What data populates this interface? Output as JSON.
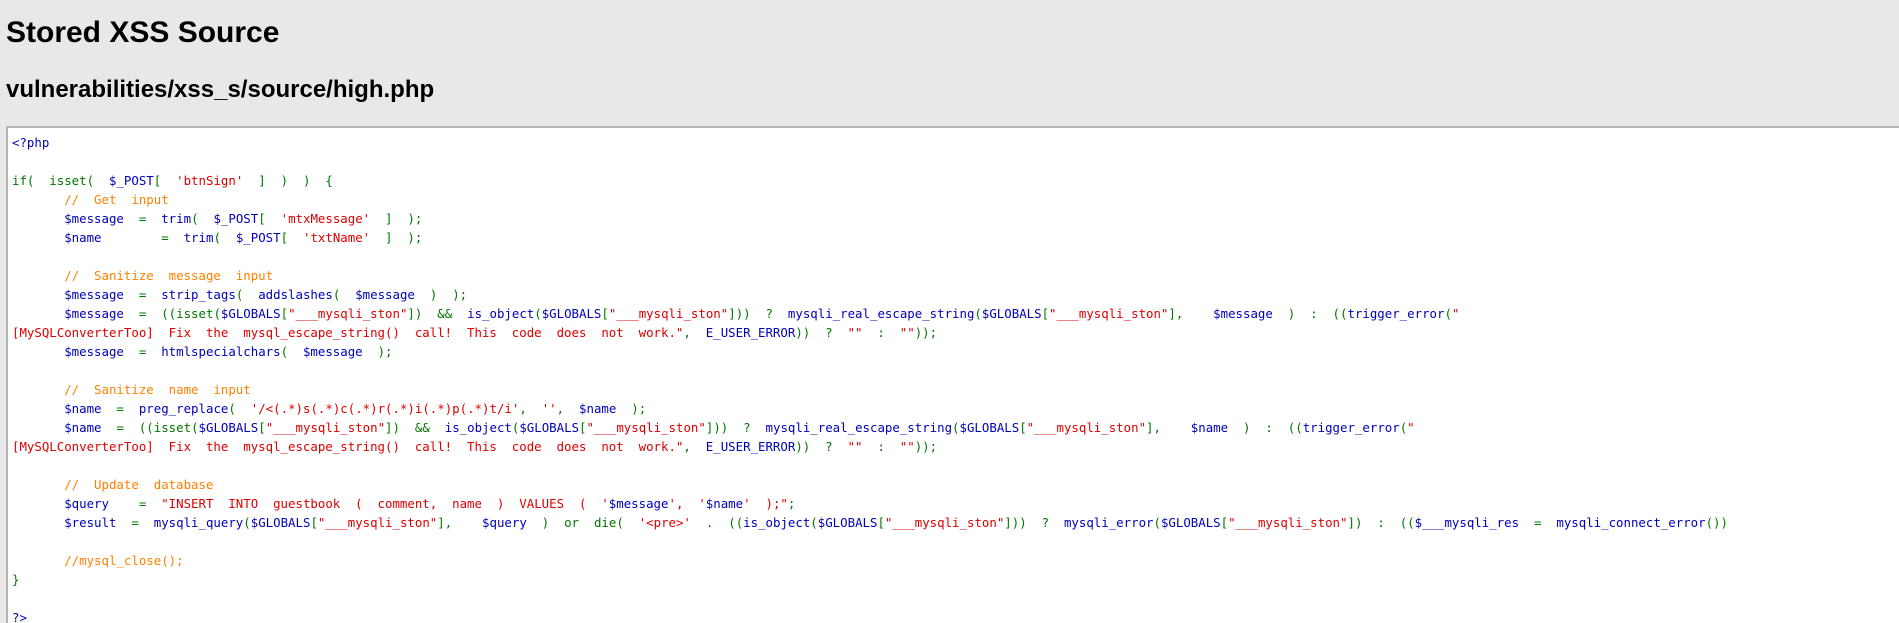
{
  "page": {
    "title": "Stored XSS Source",
    "file_path": "vulnerabilities/xss_s/source/high.php"
  },
  "source_code": {
    "lines": [
      [
        {
          "t": "<?php",
          "c": "html"
        }
      ],
      [],
      [
        {
          "t": "if(  isset(  ",
          "c": "kw"
        },
        {
          "t": "$_POST",
          "c": "var"
        },
        {
          "t": "[  ",
          "c": "kw"
        },
        {
          "t": "'btnSign'",
          "c": "str"
        },
        {
          "t": "  ]  )  )  {",
          "c": "kw"
        }
      ],
      [
        {
          "t": "       ",
          "c": "kw"
        },
        {
          "t": "//  Get  input",
          "c": "com"
        }
      ],
      [
        {
          "t": "       ",
          "c": "kw"
        },
        {
          "t": "$message",
          "c": "var"
        },
        {
          "t": "  =  ",
          "c": "kw"
        },
        {
          "t": "trim",
          "c": "var"
        },
        {
          "t": "(  ",
          "c": "kw"
        },
        {
          "t": "$_POST",
          "c": "var"
        },
        {
          "t": "[  ",
          "c": "kw"
        },
        {
          "t": "'mtxMessage'",
          "c": "str"
        },
        {
          "t": "  ]  );",
          "c": "kw"
        }
      ],
      [
        {
          "t": "       ",
          "c": "kw"
        },
        {
          "t": "$name",
          "c": "var"
        },
        {
          "t": "        =  ",
          "c": "kw"
        },
        {
          "t": "trim",
          "c": "var"
        },
        {
          "t": "(  ",
          "c": "kw"
        },
        {
          "t": "$_POST",
          "c": "var"
        },
        {
          "t": "[  ",
          "c": "kw"
        },
        {
          "t": "'txtName'",
          "c": "str"
        },
        {
          "t": "  ]  );",
          "c": "kw"
        }
      ],
      [],
      [
        {
          "t": "       ",
          "c": "kw"
        },
        {
          "t": "//  Sanitize  message  input",
          "c": "com"
        }
      ],
      [
        {
          "t": "       ",
          "c": "kw"
        },
        {
          "t": "$message",
          "c": "var"
        },
        {
          "t": "  =  ",
          "c": "kw"
        },
        {
          "t": "strip_tags",
          "c": "var"
        },
        {
          "t": "(  ",
          "c": "kw"
        },
        {
          "t": "addslashes",
          "c": "var"
        },
        {
          "t": "(  ",
          "c": "kw"
        },
        {
          "t": "$message",
          "c": "var"
        },
        {
          "t": "  )  );",
          "c": "kw"
        }
      ],
      [
        {
          "t": "       ",
          "c": "kw"
        },
        {
          "t": "$message",
          "c": "var"
        },
        {
          "t": "  =  ((",
          "c": "kw"
        },
        {
          "t": "isset",
          "c": "kw"
        },
        {
          "t": "(",
          "c": "kw"
        },
        {
          "t": "$GLOBALS",
          "c": "var"
        },
        {
          "t": "[",
          "c": "kw"
        },
        {
          "t": "\"___mysqli_ston\"",
          "c": "str"
        },
        {
          "t": "])  &&  ",
          "c": "kw"
        },
        {
          "t": "is_object",
          "c": "var"
        },
        {
          "t": "(",
          "c": "kw"
        },
        {
          "t": "$GLOBALS",
          "c": "var"
        },
        {
          "t": "[",
          "c": "kw"
        },
        {
          "t": "\"___mysqli_ston\"",
          "c": "str"
        },
        {
          "t": "]))  ?  ",
          "c": "kw"
        },
        {
          "t": "mysqli_real_escape_string",
          "c": "var"
        },
        {
          "t": "(",
          "c": "kw"
        },
        {
          "t": "$GLOBALS",
          "c": "var"
        },
        {
          "t": "[",
          "c": "kw"
        },
        {
          "t": "\"___mysqli_ston\"",
          "c": "str"
        },
        {
          "t": "],    ",
          "c": "kw"
        },
        {
          "t": "$message",
          "c": "var"
        },
        {
          "t": "  )  :  ((",
          "c": "kw"
        },
        {
          "t": "trigger_error",
          "c": "var"
        },
        {
          "t": "(",
          "c": "kw"
        },
        {
          "t": "\"",
          "c": "str"
        }
      ],
      [
        {
          "t": "[MySQLConverterToo]  Fix  the  mysql_escape_string()  call!  This  code  does  not  work.\"",
          "c": "str"
        },
        {
          "t": ",  ",
          "c": "kw"
        },
        {
          "t": "E_USER_ERROR",
          "c": "var"
        },
        {
          "t": "))  ?  ",
          "c": "kw"
        },
        {
          "t": "\"\"",
          "c": "str"
        },
        {
          "t": "  :  ",
          "c": "kw"
        },
        {
          "t": "\"\"",
          "c": "str"
        },
        {
          "t": "));",
          "c": "kw"
        }
      ],
      [
        {
          "t": "       ",
          "c": "kw"
        },
        {
          "t": "$message",
          "c": "var"
        },
        {
          "t": "  =  ",
          "c": "kw"
        },
        {
          "t": "htmlspecialchars",
          "c": "var"
        },
        {
          "t": "(  ",
          "c": "kw"
        },
        {
          "t": "$message",
          "c": "var"
        },
        {
          "t": "  );",
          "c": "kw"
        }
      ],
      [],
      [
        {
          "t": "       ",
          "c": "kw"
        },
        {
          "t": "//  Sanitize  name  input",
          "c": "com"
        }
      ],
      [
        {
          "t": "       ",
          "c": "kw"
        },
        {
          "t": "$name",
          "c": "var"
        },
        {
          "t": "  =  ",
          "c": "kw"
        },
        {
          "t": "preg_replace",
          "c": "var"
        },
        {
          "t": "(  ",
          "c": "kw"
        },
        {
          "t": "'/<(.*)s(.*)c(.*)r(.*)i(.*)p(.*)t/i'",
          "c": "str"
        },
        {
          "t": ",  ",
          "c": "kw"
        },
        {
          "t": "''",
          "c": "str"
        },
        {
          "t": ",  ",
          "c": "kw"
        },
        {
          "t": "$name",
          "c": "var"
        },
        {
          "t": "  );",
          "c": "kw"
        }
      ],
      [
        {
          "t": "       ",
          "c": "kw"
        },
        {
          "t": "$name",
          "c": "var"
        },
        {
          "t": "  =  ((",
          "c": "kw"
        },
        {
          "t": "isset",
          "c": "kw"
        },
        {
          "t": "(",
          "c": "kw"
        },
        {
          "t": "$GLOBALS",
          "c": "var"
        },
        {
          "t": "[",
          "c": "kw"
        },
        {
          "t": "\"___mysqli_ston\"",
          "c": "str"
        },
        {
          "t": "])  &&  ",
          "c": "kw"
        },
        {
          "t": "is_object",
          "c": "var"
        },
        {
          "t": "(",
          "c": "kw"
        },
        {
          "t": "$GLOBALS",
          "c": "var"
        },
        {
          "t": "[",
          "c": "kw"
        },
        {
          "t": "\"___mysqli_ston\"",
          "c": "str"
        },
        {
          "t": "]))  ?  ",
          "c": "kw"
        },
        {
          "t": "mysqli_real_escape_string",
          "c": "var"
        },
        {
          "t": "(",
          "c": "kw"
        },
        {
          "t": "$GLOBALS",
          "c": "var"
        },
        {
          "t": "[",
          "c": "kw"
        },
        {
          "t": "\"___mysqli_ston\"",
          "c": "str"
        },
        {
          "t": "],    ",
          "c": "kw"
        },
        {
          "t": "$name",
          "c": "var"
        },
        {
          "t": "  )  :  ((",
          "c": "kw"
        },
        {
          "t": "trigger_error",
          "c": "var"
        },
        {
          "t": "(",
          "c": "kw"
        },
        {
          "t": "\"",
          "c": "str"
        }
      ],
      [
        {
          "t": "[MySQLConverterToo]  Fix  the  mysql_escape_string()  call!  This  code  does  not  work.\"",
          "c": "str"
        },
        {
          "t": ",  ",
          "c": "kw"
        },
        {
          "t": "E_USER_ERROR",
          "c": "var"
        },
        {
          "t": "))  ?  ",
          "c": "kw"
        },
        {
          "t": "\"\"",
          "c": "str"
        },
        {
          "t": "  :  ",
          "c": "kw"
        },
        {
          "t": "\"\"",
          "c": "str"
        },
        {
          "t": "));",
          "c": "kw"
        }
      ],
      [],
      [
        {
          "t": "       ",
          "c": "kw"
        },
        {
          "t": "//  Update  database",
          "c": "com"
        }
      ],
      [
        {
          "t": "       ",
          "c": "kw"
        },
        {
          "t": "$query",
          "c": "var"
        },
        {
          "t": "    =  ",
          "c": "kw"
        },
        {
          "t": "\"INSERT  INTO  guestbook  (  comment,  name  )  VALUES  (  '",
          "c": "str"
        },
        {
          "t": "$message",
          "c": "var"
        },
        {
          "t": "',  '",
          "c": "str"
        },
        {
          "t": "$name",
          "c": "var"
        },
        {
          "t": "'  );\"",
          "c": "str"
        },
        {
          "t": ";",
          "c": "kw"
        }
      ],
      [
        {
          "t": "       ",
          "c": "kw"
        },
        {
          "t": "$result",
          "c": "var"
        },
        {
          "t": "  =  ",
          "c": "kw"
        },
        {
          "t": "mysqli_query",
          "c": "var"
        },
        {
          "t": "(",
          "c": "kw"
        },
        {
          "t": "$GLOBALS",
          "c": "var"
        },
        {
          "t": "[",
          "c": "kw"
        },
        {
          "t": "\"___mysqli_ston\"",
          "c": "str"
        },
        {
          "t": "],    ",
          "c": "kw"
        },
        {
          "t": "$query",
          "c": "var"
        },
        {
          "t": "  )  or  ",
          "c": "kw"
        },
        {
          "t": "die",
          "c": "kw"
        },
        {
          "t": "(  ",
          "c": "kw"
        },
        {
          "t": "'<pre>'",
          "c": "str"
        },
        {
          "t": "  .  ((",
          "c": "kw"
        },
        {
          "t": "is_object",
          "c": "var"
        },
        {
          "t": "(",
          "c": "kw"
        },
        {
          "t": "$GLOBALS",
          "c": "var"
        },
        {
          "t": "[",
          "c": "kw"
        },
        {
          "t": "\"___mysqli_ston\"",
          "c": "str"
        },
        {
          "t": "]))  ?  ",
          "c": "kw"
        },
        {
          "t": "mysqli_error",
          "c": "var"
        },
        {
          "t": "(",
          "c": "kw"
        },
        {
          "t": "$GLOBALS",
          "c": "var"
        },
        {
          "t": "[",
          "c": "kw"
        },
        {
          "t": "\"___mysqli_ston\"",
          "c": "str"
        },
        {
          "t": "])  :  ((",
          "c": "kw"
        },
        {
          "t": "$___mysqli_res",
          "c": "var"
        },
        {
          "t": "  =  ",
          "c": "kw"
        },
        {
          "t": "mysqli_connect_error",
          "c": "var"
        },
        {
          "t": "())",
          "c": "kw"
        }
      ],
      [],
      [
        {
          "t": "       ",
          "c": "kw"
        },
        {
          "t": "//mysql_close();",
          "c": "com"
        }
      ],
      [
        {
          "t": "}",
          "c": "kw"
        }
      ],
      [],
      [
        {
          "t": "?>",
          "c": "html"
        }
      ]
    ]
  },
  "colors": {
    "background": "#e8e8e8",
    "code_background": "#ffffff",
    "keyword": "#007700",
    "string": "#dd0000",
    "variable": "#0000bb",
    "comment": "#ff8000"
  }
}
